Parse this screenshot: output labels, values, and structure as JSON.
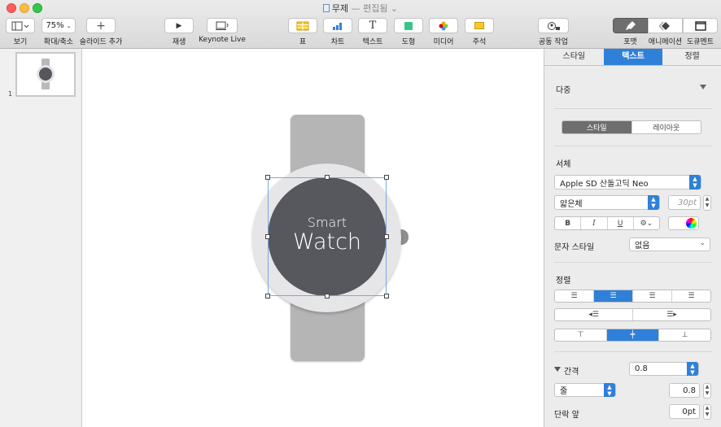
{
  "window": {
    "title": "무제",
    "subtitle": "— 편집됨 ⌄",
    "colors": {
      "close": "#fc605b",
      "minimize": "#fdbc40",
      "zoom": "#34c84a",
      "accent": "#2f80d8"
    }
  },
  "toolbar": {
    "view_label": "보기",
    "zoom_value": "75%",
    "zoom_label": "확대/축소",
    "add_slide_label": "슬라이드 추가",
    "play_label": "재생",
    "keynote_live_label": "Keynote Live",
    "table_label": "표",
    "chart_label": "차트",
    "text_label": "텍스트",
    "shape_label": "도형",
    "media_label": "미디어",
    "comment_label": "주석",
    "collaborate_label": "공동 작업",
    "format_label": "포맷",
    "animate_label": "애니메이션",
    "document_label": "도큐멘트"
  },
  "navigator": {
    "slide_number": "1"
  },
  "slide": {
    "line1": "Smart",
    "line2": "Watch"
  },
  "inspector": {
    "tabs": [
      "스타일",
      "텍스트",
      "정렬"
    ],
    "selected_tab": "텍스트",
    "paragraph_style": "다중",
    "segment": [
      "스타일",
      "레이아웃"
    ],
    "font_section": "서체",
    "font_family": "Apple SD 산돌고딕 Neo",
    "font_weight": "얇은체",
    "font_size": "30pt",
    "bold": "B",
    "italic": "I",
    "underline": "U",
    "gear": "⚙⌄",
    "char_style_label": "문자 스타일",
    "char_style_value": "없음",
    "alignment_section": "정렬",
    "spacing_label": "간격",
    "spacing_value": "0.8",
    "line_mode": "줄",
    "line_value": "0.8",
    "before_paragraph_label": "단락 앞",
    "before_paragraph_value": "0pt"
  }
}
